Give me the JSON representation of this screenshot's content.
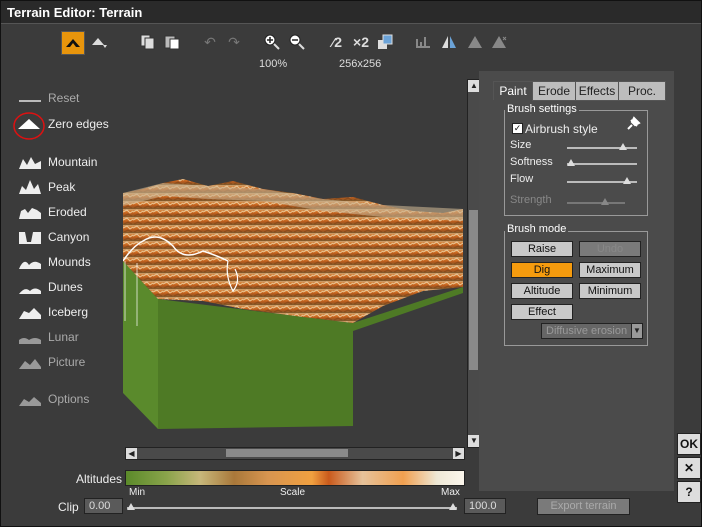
{
  "window": {
    "title": "Terrain Editor: Terrain"
  },
  "toolbar": {
    "zoom_level": "100%",
    "resolution": "256x256",
    "half_label": "2",
    "double_label": "×2"
  },
  "left_tools": [
    {
      "label": "Reset",
      "icon": "reset-icon"
    },
    {
      "label": "Zero edges",
      "icon": "zero-edges-icon"
    },
    {
      "label": "Mountain",
      "icon": "mountain-icon"
    },
    {
      "label": "Peak",
      "icon": "peak-icon"
    },
    {
      "label": "Eroded",
      "icon": "eroded-icon"
    },
    {
      "label": "Canyon",
      "icon": "canyon-icon"
    },
    {
      "label": "Mounds",
      "icon": "mounds-icon"
    },
    {
      "label": "Dunes",
      "icon": "dunes-icon"
    },
    {
      "label": "Iceberg",
      "icon": "iceberg-icon"
    },
    {
      "label": "Lunar",
      "icon": "lunar-icon"
    },
    {
      "label": "Picture",
      "icon": "picture-icon"
    },
    {
      "label": "Options",
      "icon": "options-icon"
    }
  ],
  "tabs": [
    {
      "label": "Paint"
    },
    {
      "label": "Erode"
    },
    {
      "label": "Effects"
    },
    {
      "label": "Proc."
    }
  ],
  "brush_settings": {
    "title": "Brush settings",
    "airbrush_label": "Airbrush style",
    "airbrush_checked": true,
    "size_label": "Size",
    "size_value": 0.8,
    "softness_label": "Softness",
    "softness_value": 0.05,
    "flow_label": "Flow",
    "flow_value": 0.85,
    "strength_label": "Strength",
    "strength_value": 0.65
  },
  "brush_mode": {
    "title": "Brush mode",
    "raise": "Raise",
    "undo": "Undo",
    "dig": "Dig",
    "maximum": "Maximum",
    "altitude": "Altitude",
    "minimum": "Minimum",
    "effect": "Effect",
    "effect_select": "Diffusive erosion",
    "selected": "Dig"
  },
  "altitudes": {
    "label": "Altitudes",
    "min": "Min",
    "scale": "Scale",
    "max": "Max"
  },
  "clip": {
    "label": "Clip",
    "min_value": "0.00",
    "max_value": "100.0"
  },
  "export_label": "Export terrain",
  "side_buttons": {
    "ok": "OK",
    "cancel": "✕",
    "help": "?"
  },
  "colors": {
    "accent": "#f59b0e",
    "ground": "#4e7a25"
  }
}
